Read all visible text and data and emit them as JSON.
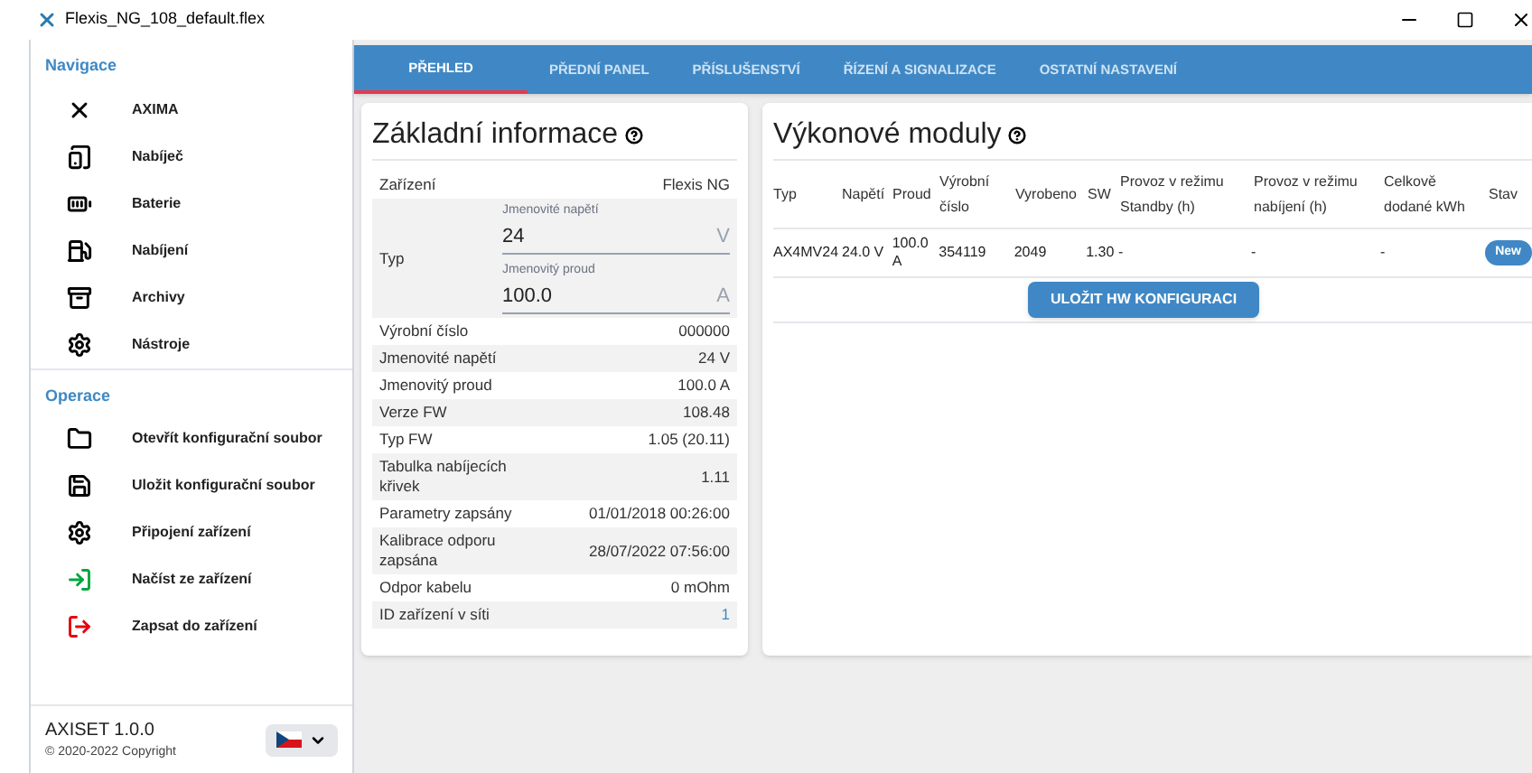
{
  "window": {
    "title": "Flexis_NG_108_default.flex"
  },
  "sidebar": {
    "sections": [
      {
        "heading": "Navigace",
        "items": [
          {
            "label": "AXIMA"
          },
          {
            "label": "Nabíječ"
          },
          {
            "label": "Baterie"
          },
          {
            "label": "Nabíjení"
          },
          {
            "label": "Archivy"
          },
          {
            "label": "Nástroje"
          }
        ]
      },
      {
        "heading": "Operace",
        "items": [
          {
            "label": "Otevřít konfigurační soubor"
          },
          {
            "label": "Uložit konfigurační soubor"
          },
          {
            "label": "Připojení zařízení"
          },
          {
            "label": "Načíst ze zařízení"
          },
          {
            "label": "Zapsat do zařízení"
          }
        ]
      }
    ],
    "footer": {
      "app": "AXISET 1.0.0",
      "copyright": "© 2020-2022 Copyright"
    }
  },
  "tabs": [
    {
      "label": "PŘEHLED",
      "selected": true
    },
    {
      "label": "PŘEDNÍ PANEL",
      "selected": false
    },
    {
      "label": "PŘÍSLUŠENSTVÍ",
      "selected": false
    },
    {
      "label": "ŘÍZENÍ A SIGNALIZACE",
      "selected": false
    },
    {
      "label": "OSTATNÍ NASTAVENÍ",
      "selected": false
    }
  ],
  "basic_info": {
    "title": "Základní informace",
    "rows": [
      {
        "kind": "text",
        "label": "Zařízení",
        "value": "Flexis NG"
      },
      {
        "kind": "fields",
        "label": "Typ",
        "fields": [
          {
            "label": "Jmenovité napětí",
            "value": "24",
            "unit": "V"
          },
          {
            "label": "Jmenovitý proud",
            "value": "100.0",
            "unit": "A"
          }
        ]
      },
      {
        "kind": "text",
        "label": "Výrobní číslo",
        "value": "000000"
      },
      {
        "kind": "text",
        "label": "Jmenovité napětí",
        "value": "24 V"
      },
      {
        "kind": "text",
        "label": "Jmenovitý proud",
        "value": "100.0 A"
      },
      {
        "kind": "text",
        "label": "Verze FW",
        "value": "108.48"
      },
      {
        "kind": "text",
        "label": "Typ FW",
        "value": "1.05 (20.11)"
      },
      {
        "kind": "text",
        "label": "Tabulka nabíjecích křivek",
        "value": "1.11"
      },
      {
        "kind": "text",
        "label": "Parametry zapsány",
        "value": "01/01/2018 00:26:00"
      },
      {
        "kind": "text",
        "label": "Kalibrace odporu zapsána",
        "value": "28/07/2022 07:56:00"
      },
      {
        "kind": "text",
        "label": "Odpor kabelu",
        "value": "0 mOhm"
      },
      {
        "kind": "link",
        "label": "ID zařízení v síti",
        "value": "1"
      }
    ]
  },
  "power_modules": {
    "title": "Výkonové moduly",
    "columns": [
      "Typ",
      "Napětí",
      "Proud",
      "Výrobní číslo",
      "Vyrobeno",
      "SW",
      "Provoz v režimu Standby (h)",
      "Provoz v režimu nabíjení (h)",
      "Celkově dodané kWh",
      "Stav"
    ],
    "rows": [
      {
        "cells": [
          "AX4MV24",
          "24.0 V",
          "100.0 A",
          "354119",
          "2049",
          "1.30",
          "-",
          "-",
          "-"
        ],
        "status": "New"
      }
    ],
    "save_button": "ULOŽIT HW KONFIGURACI"
  }
}
